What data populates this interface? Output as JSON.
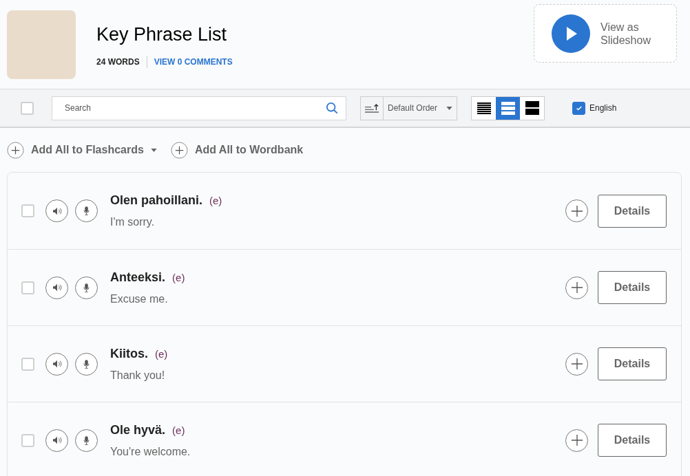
{
  "header": {
    "title": "Key Phrase List",
    "word_count": "24 WORDS",
    "comments_link": "VIEW 0 COMMENTS",
    "slideshow_button": "View as Slideshow"
  },
  "toolbar": {
    "select_all": {
      "checked": false
    },
    "search": {
      "placeholder": "Search"
    },
    "sort": {
      "value": "Default Order"
    },
    "view_modes": [
      {
        "kind": "dense",
        "selected": false
      },
      {
        "kind": "normal",
        "selected": true
      },
      {
        "kind": "large",
        "selected": false
      }
    ],
    "translation_toggle": {
      "label": "English",
      "checked": true
    }
  },
  "actions": [
    {
      "label": "Add All to Flashcards",
      "has_menu": true
    },
    {
      "label": "Add All to Wordbank",
      "has_menu": false
    }
  ],
  "phrases": [
    {
      "phrase": "Olen pahoillani.",
      "tag": "(e)",
      "translation": "I'm sorry.",
      "checked": false,
      "details": "Details"
    },
    {
      "phrase": "Anteeksi.",
      "tag": "(e)",
      "translation": "Excuse me.",
      "checked": false,
      "details": "Details"
    },
    {
      "phrase": "Kiitos.",
      "tag": "(e)",
      "translation": "Thank you!",
      "checked": false,
      "details": "Details"
    },
    {
      "phrase": "Ole hyvä.",
      "tag": "(e)",
      "translation": "You're welcome.",
      "checked": false,
      "details": "Details"
    }
  ]
}
